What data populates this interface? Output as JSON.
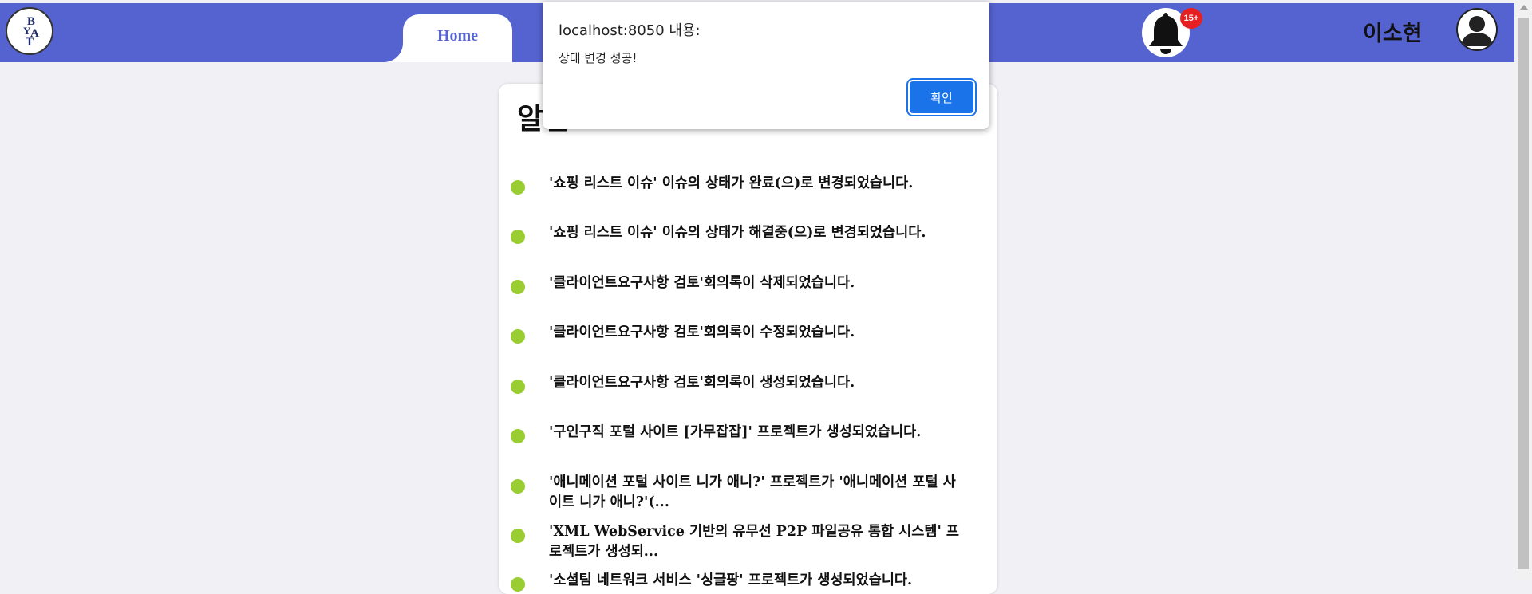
{
  "header": {
    "logo_letters": [
      "B",
      "Y",
      "A",
      "T"
    ],
    "home_tab": "Home",
    "notification_badge": "15+",
    "username": "이소현"
  },
  "card": {
    "title": "알림",
    "items": [
      {
        "text": "'쇼핑 리스트 이슈' 이슈의 상태가 완료(으)로 변경되었습니다."
      },
      {
        "text": "'쇼핑 리스트 이슈' 이슈의 상태가 해결중(으)로 변경되었습니다."
      },
      {
        "text": "'클라이언트요구사항 검토'회의록이 삭제되었습니다."
      },
      {
        "text": "'클라이언트요구사항 검토'회의록이 수정되었습니다."
      },
      {
        "text": "'클라이언트요구사항 검토'회의록이 생성되었습니다."
      },
      {
        "text": "'구인구직 포털 사이트 [가무잡잡]' 프로젝트가 생성되었습니다."
      },
      {
        "text": "'애니메이션 포털 사이트 니가 애니?' 프로젝트가 '애니메이션 포털 사이트 니가 애니?'(..."
      },
      {
        "text": "'XML WebService 기반의 유무선 P2P 파일공유 통합 시스템' 프로젝트가 생성되..."
      },
      {
        "text": "'소셜팀 네트워크 서비스 '싱글팡' 프로젝트가 생성되었습니다."
      }
    ]
  },
  "dialog": {
    "title": "localhost:8050 내용:",
    "message": "상태 변경 성공!",
    "ok_label": "확인"
  },
  "colors": {
    "header_bg": "#5563d1",
    "dot": "#9acd32",
    "badge": "#e62020",
    "button": "#1a73e8"
  }
}
